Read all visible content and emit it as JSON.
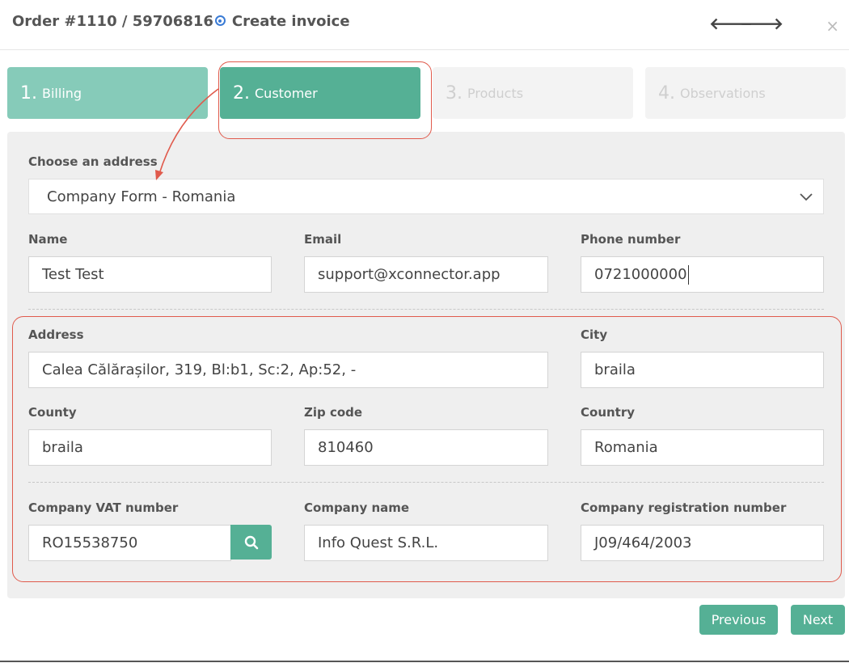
{
  "header": {
    "order": "Order #1110 / 59706816",
    "subtitle": "Create invoice",
    "prev_icon": "arrow-left-icon",
    "next_icon": "arrow-right-icon",
    "close_icon": "close-icon",
    "prev_glyph": "🡐",
    "next_glyph": "🡒",
    "close_glyph": "×"
  },
  "steps": [
    {
      "num": "1.",
      "label": "Billing"
    },
    {
      "num": "2.",
      "label": "Customer"
    },
    {
      "num": "3.",
      "label": "Products"
    },
    {
      "num": "4.",
      "label": "Observations"
    }
  ],
  "address_select": {
    "label": "Choose an address",
    "value": "Company Form - Romania"
  },
  "contact": {
    "name": {
      "label": "Name",
      "value": "Test Test"
    },
    "email": {
      "label": "Email",
      "value": "support@xconnector.app"
    },
    "phone": {
      "label": "Phone number",
      "value": "0721000000"
    }
  },
  "address": {
    "address": {
      "label": "Address",
      "value": "Calea Călărașilor, 319, Bl:b1, Sc:2, Ap:52, -"
    },
    "city": {
      "label": "City",
      "value": "braila"
    },
    "county": {
      "label": "County",
      "value": "braila"
    },
    "zip": {
      "label": "Zip code",
      "value": "810460"
    },
    "country": {
      "label": "Country",
      "value": "Romania"
    }
  },
  "company": {
    "vat": {
      "label": "Company VAT number",
      "value": "RO15538750"
    },
    "name": {
      "label": "Company name",
      "value": "Info Quest S.R.L."
    },
    "reg": {
      "label": "Company registration number",
      "value": "J09/464/2003"
    }
  },
  "footer": {
    "previous": "Previous",
    "next": "Next"
  },
  "colors": {
    "accent": "#55b095",
    "accent_light": "#86cbb9",
    "highlight": "#e05a4c"
  }
}
